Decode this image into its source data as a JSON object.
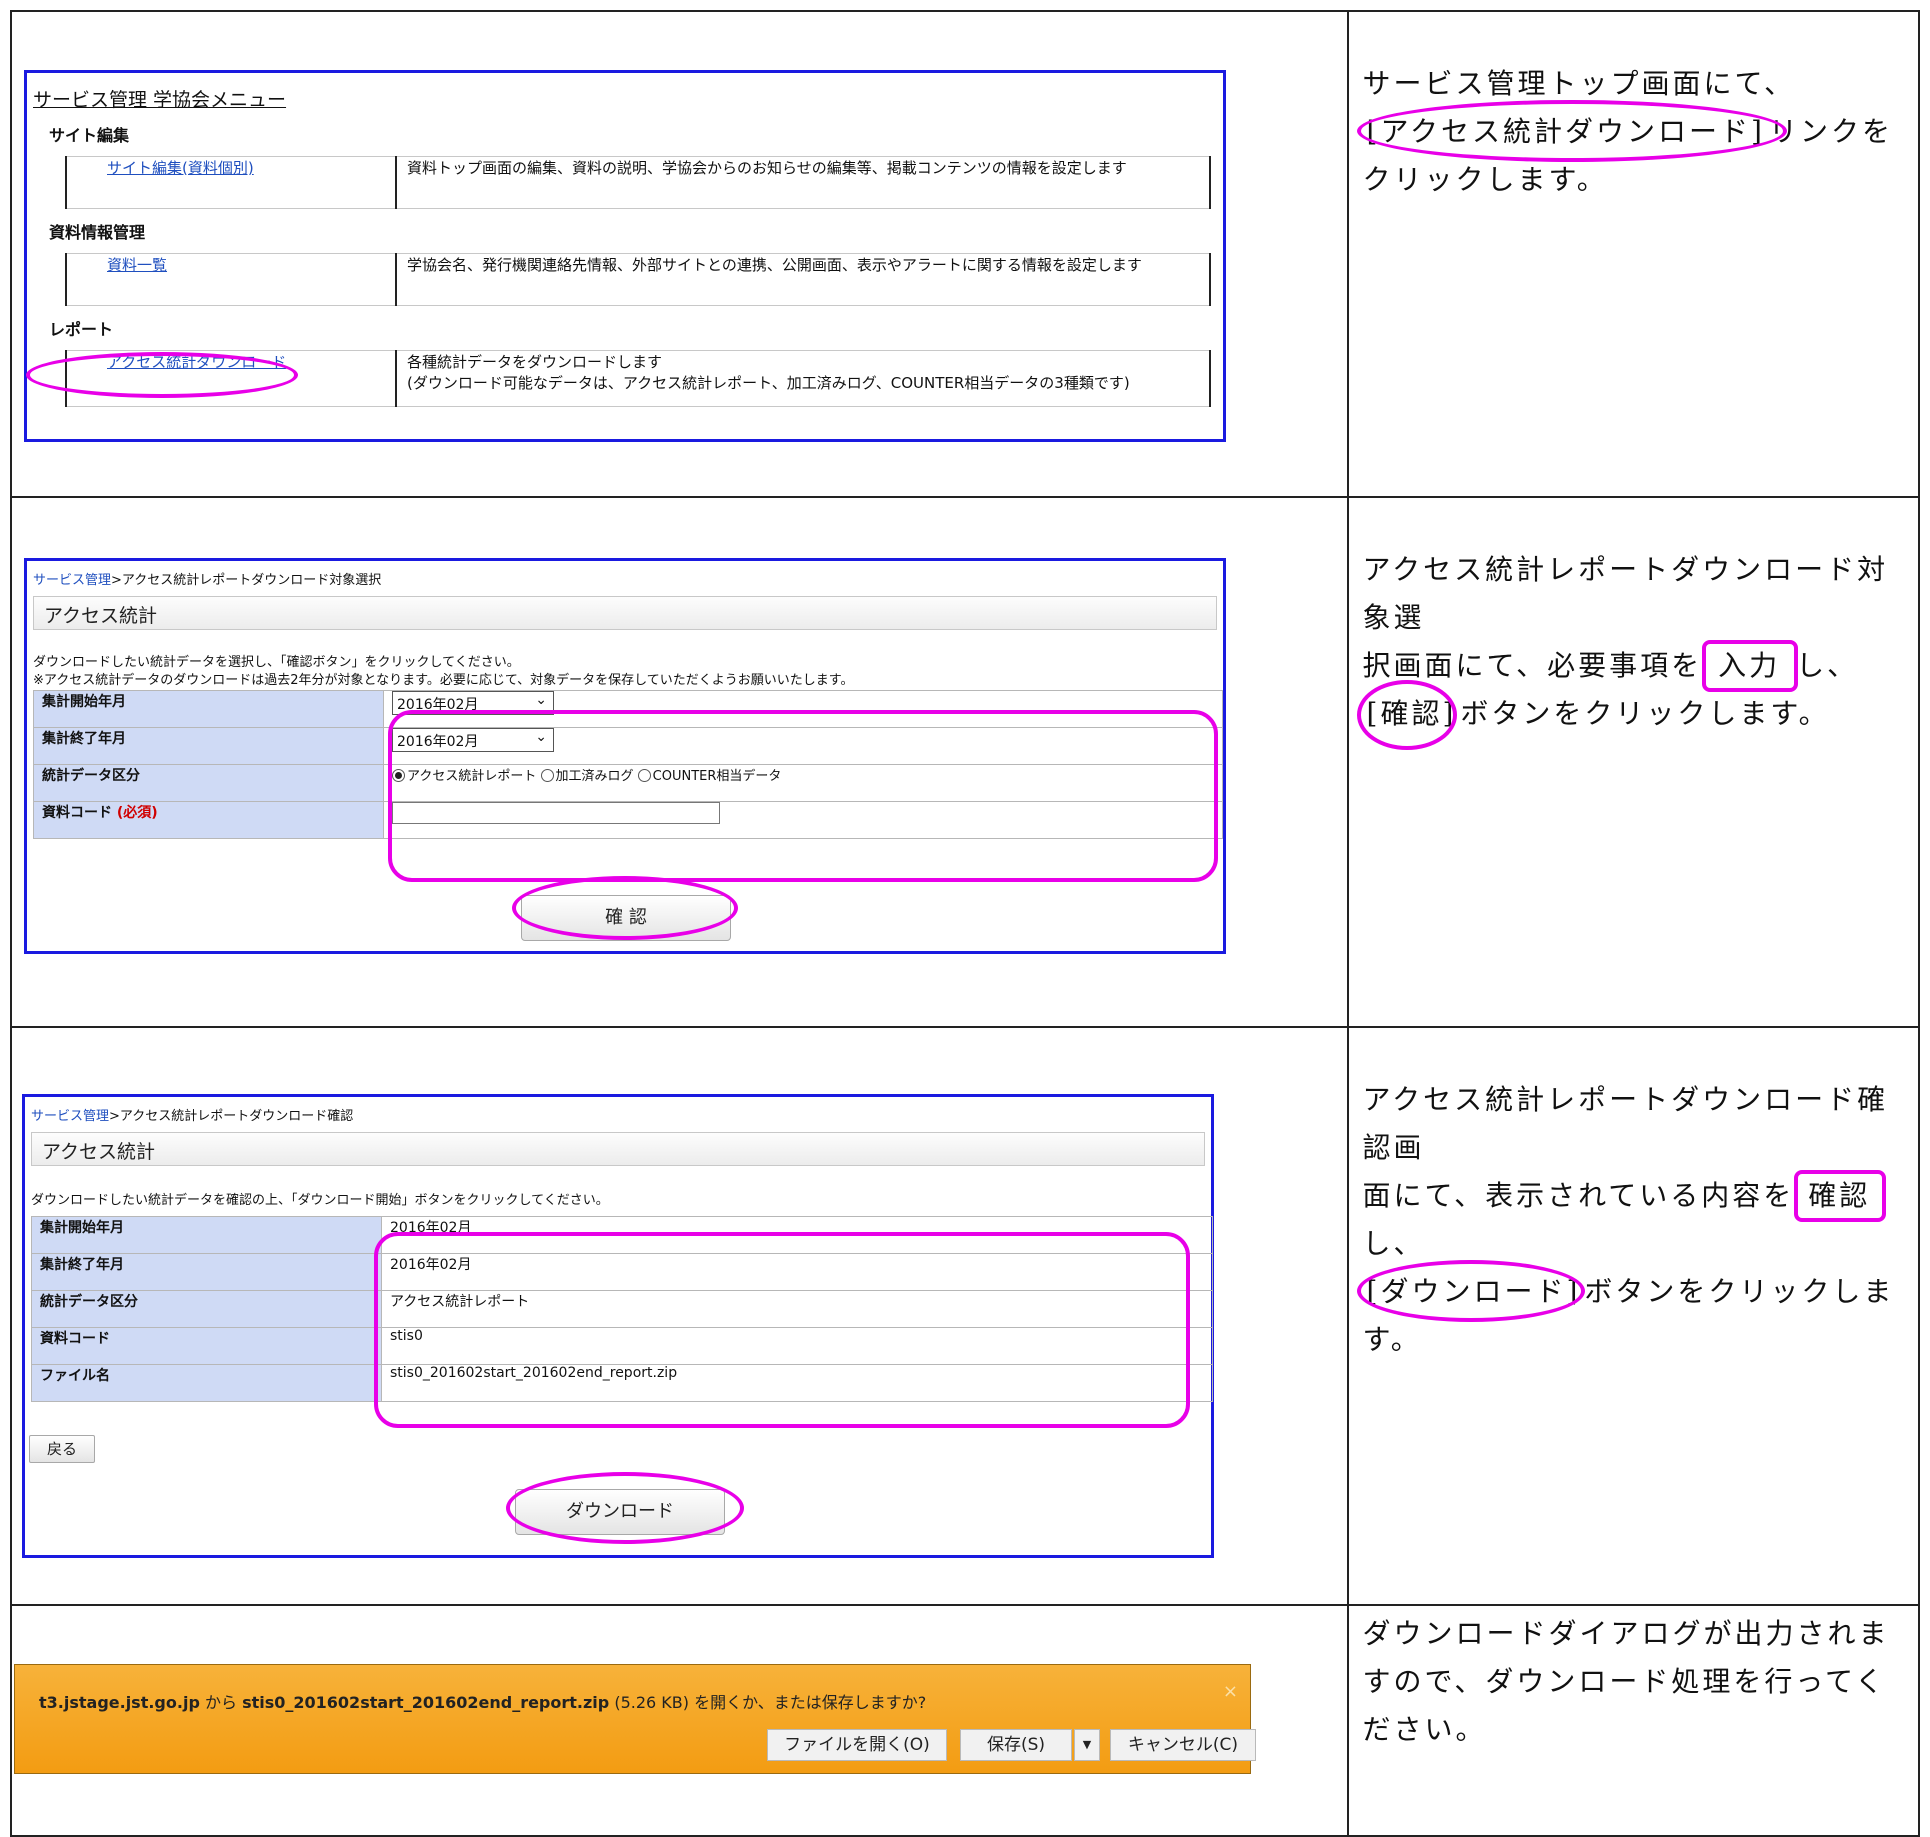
{
  "step1": {
    "menu_title": "サービス管理 学協会メニュー",
    "sections": [
      {
        "heading": "サイト編集",
        "link": "サイト編集(資料個別)",
        "desc": "資料トップ画面の編集、資料の説明、学協会からのお知らせの編集等、掲載コンテンツの情報を設定します"
      },
      {
        "heading": "資料情報管理",
        "link": "資料一覧",
        "desc": "学協会名、発行機関連絡先情報、外部サイトとの連携、公開画面、表示やアラートに関する情報を設定します"
      },
      {
        "heading": "レポート",
        "link": "アクセス統計ダウンロード",
        "desc": "各種統計データをダウンロードします",
        "desc2": "(ダウンロード可能なデータは、アクセス統計レポート、加工済みログ、COUNTER相当データの3種類です)"
      }
    ],
    "instruction": {
      "pre": "サービス管理トップ画面にて、",
      "hl": "[アクセス統計ダウンロード]",
      "post": "リンクをクリックします。"
    }
  },
  "step2": {
    "crumb_link": "サービス管理",
    "crumb_rest": ">アクセス統計レポートダウンロード対象選択",
    "title": "アクセス統計",
    "help1": "ダウンロードしたい統計データを選択し、「確認ボタン」をクリックしてください。",
    "help2": "※アクセス統計データのダウンロードは過去2年分が対象となります。必要に応じて、対象データを保存していただくようお願いいたします。",
    "rows": {
      "start_label": "集計開始年月",
      "start_value": "2016年02月",
      "end_label": "集計終了年月",
      "end_value": "2016年02月",
      "type_label": "統計データ区分",
      "type_opt1": "アクセス統計レポート",
      "type_opt2": "加工済みログ",
      "type_opt3": "COUNTER相当データ",
      "code_label": "資料コード",
      "code_required": "(必須)"
    },
    "confirm_button": "確 認",
    "instruction": {
      "l1": "アクセス統計レポートダウンロード対象選",
      "l2_pre": "択画面にて、必要事項を",
      "l2_hl": "入力",
      "l2_post": "し、",
      "l3_hl": "[確認]",
      "l3_post": "ボタンをクリックします。"
    }
  },
  "step3": {
    "crumb_link": "サービス管理",
    "crumb_rest": ">アクセス統計レポートダウンロード確認",
    "title": "アクセス統計",
    "help": "ダウンロードしたい統計データを確認の上、「ダウンロード開始」ボタンをクリックしてください。",
    "rows": [
      {
        "label": "集計開始年月",
        "value": "2016年02月"
      },
      {
        "label": "集計終了年月",
        "value": "2016年02月"
      },
      {
        "label": "統計データ区分",
        "value": "アクセス統計レポート"
      },
      {
        "label": "資料コード",
        "value": "stis0"
      },
      {
        "label": "ファイル名",
        "value": "stis0_201602start_201602end_report.zip"
      }
    ],
    "back_button": "戻る",
    "download_button": "ダウンロード",
    "instruction": {
      "l1": "アクセス統計レポートダウンロード確認画",
      "l2_pre": "面にて、表示されている内容を",
      "l2_hl": "確認",
      "l2_post": "し、",
      "l3_hl": "[ダウンロード]",
      "l3_post": "ボタンをクリックしま",
      "l4": "す。"
    }
  },
  "step4": {
    "host": "t3.jstage.jst.go.jp",
    "from": " から ",
    "file": "stis0_201602start_201602end_report.zip",
    "size": " (5.26 KB) ",
    "question": "を開くか、または保存しますか?",
    "open_button": "ファイルを開く(O)",
    "save_button": "保存(S)",
    "cancel_button": "キャンセル(C)",
    "close": "×",
    "instruction": "ダウンロードダイアログが出力されますので、ダウンロード処理を行ってください。"
  }
}
